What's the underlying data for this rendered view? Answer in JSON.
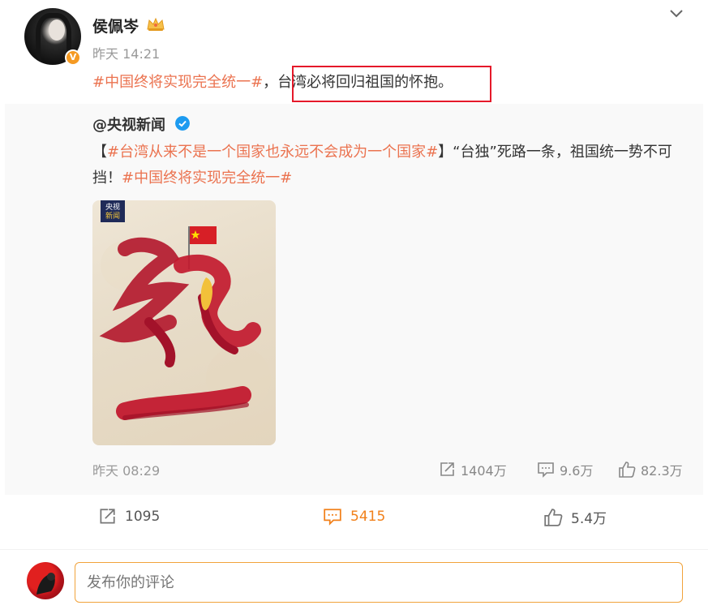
{
  "post": {
    "username": "侯佩岑",
    "time": "昨天 14:21",
    "text_tag": "#中国终将实现完全统一#",
    "text_sep": "，",
    "text_main": "台湾必将回归祖国的怀抱。",
    "verified_badge": "V",
    "icons": {
      "crown": "crown-icon",
      "collapse": "chevron-down-icon"
    }
  },
  "repost": {
    "username": "@央视新闻",
    "bracket_open": "【",
    "tag1": "#台湾从来不是一个国家也永远不会成为一个国家#",
    "bracket_close": "】",
    "body": "“台独”死路一条，祖国统一势不可挡！",
    "tag2": "#中国终将实现完全统一#",
    "image_logo_line1": "央视",
    "image_logo_line2": "新闻",
    "time": "昨天 08:29",
    "stats": {
      "reposts": "1404万",
      "comments": "9.6万",
      "likes": "82.3万"
    }
  },
  "actions": {
    "reposts": "1095",
    "comments": "5415",
    "likes": "5.4万"
  },
  "comment": {
    "placeholder": "发布你的评论"
  },
  "colors": {
    "tag": "#eb7350",
    "highlight": "#e5192a",
    "accent": "#f1801a",
    "verified_blue": "#1d9bf0",
    "vip_orange": "#f59a23"
  }
}
